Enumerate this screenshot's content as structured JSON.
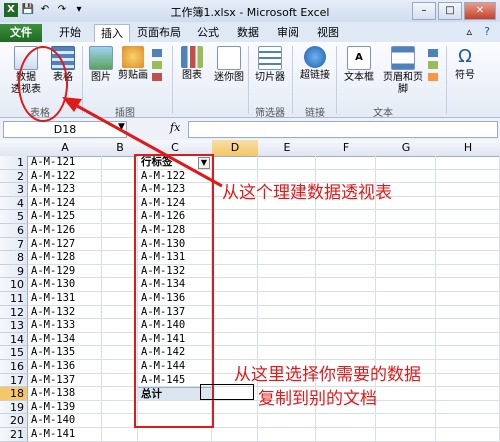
{
  "window": {
    "title": "工作簿1.xlsx - Microsoft Excel",
    "minimize": "–",
    "maximize": "□",
    "close": "✕"
  },
  "qat": [
    "icon",
    "save",
    "undo",
    "redo",
    "more"
  ],
  "tabs": [
    "文件",
    "开始",
    "插入",
    "页面布局",
    "公式",
    "数据",
    "审阅",
    "视图"
  ],
  "ribbon": {
    "pivot": "数据\n透视表",
    "pivot_line1": "数据",
    "pivot_line2": "透视表",
    "table": "表格",
    "picture": "图片",
    "clipart": "剪贴画",
    "chart": "图表",
    "sparkline": "迷你图",
    "slicer": "切片器",
    "hyperlink": "超链接",
    "textbox": "文本框",
    "header_footer": "页眉和页脚",
    "symbol": "符号",
    "group_tables": "表格",
    "group_illustrations": "插图",
    "group_filter": "筛选器",
    "group_links": "链接",
    "group_text": "文本"
  },
  "formula_bar": {
    "name_box": "D18",
    "fx": "fx",
    "formula": ""
  },
  "columns": [
    "A",
    "B",
    "C",
    "D",
    "E",
    "F",
    "G",
    "H"
  ],
  "rows": [
    "1",
    "2",
    "3",
    "4",
    "5",
    "6",
    "7",
    "8",
    "9",
    "10",
    "11",
    "12",
    "13",
    "14",
    "15",
    "16",
    "17",
    "18",
    "19",
    "20",
    "21"
  ],
  "col_a": [
    "A-M-121",
    "A-M-122",
    "A-M-123",
    "A-M-124",
    "A-M-125",
    "A-M-126",
    "A-M-127",
    "A-M-128",
    "A-M-129",
    "A-M-130",
    "A-M-131",
    "A-M-132",
    "A-M-133",
    "A-M-134",
    "A-M-135",
    "A-M-136",
    "A-M-137",
    "A-M-138",
    "A-M-139",
    "A-M-140",
    "A-M-141"
  ],
  "pivot": {
    "header": "行标签",
    "items": [
      "A-M-122",
      "A-M-123",
      "A-M-124",
      "A-M-126",
      "A-M-128",
      "A-M-130",
      "A-M-131",
      "A-M-132",
      "A-M-134",
      "A-M-136",
      "A-M-137",
      "A-M-140",
      "A-M-141",
      "A-M-142",
      "A-M-144",
      "A-M-145"
    ],
    "total": "总计"
  },
  "annotations": {
    "top": "从这个理建数据透视表",
    "bottom_line1": "从这里选择你需要的数据",
    "bottom_line2": "复制到别的文档"
  },
  "colors": {
    "annotation": "#e01a1a",
    "file_tab": "#1f6b23",
    "selection": "#f4c86a"
  }
}
